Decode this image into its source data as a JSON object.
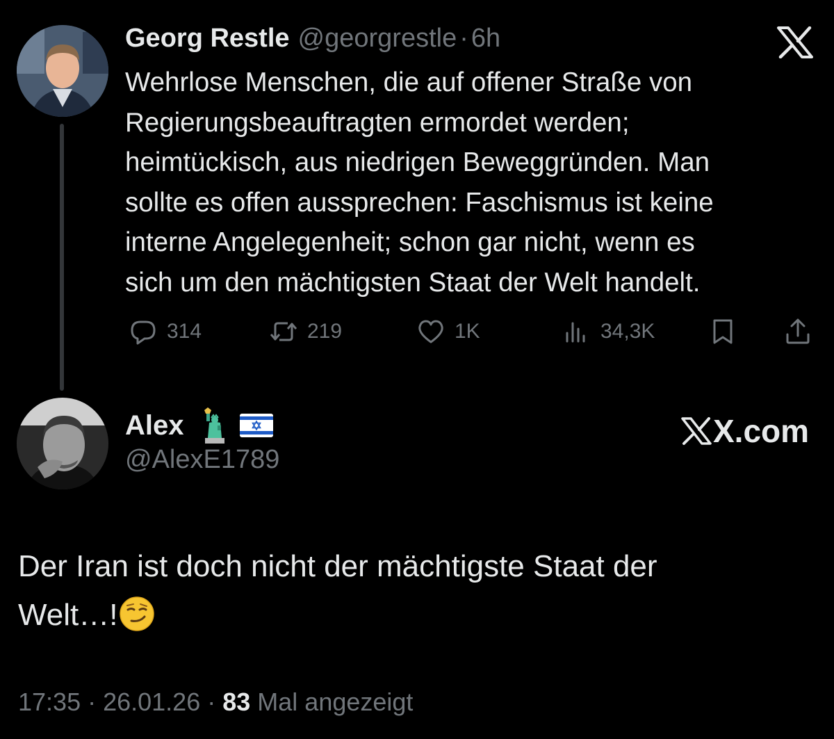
{
  "tweet": {
    "author": {
      "display_name": "Georg Restle",
      "handle": "@georgrestle",
      "separator": "·",
      "time": "6h"
    },
    "text_lines": [
      "Wehrlose Menschen, die auf offener Straße von",
      "Regierungsbeauftragten ermordet werden;",
      "heimtückisch, aus niedrigen Beweggründen. Man",
      "sollte es offen aussprechen: Faschismus ist keine",
      "interne Angelegenheit; schon gar nicht, wenn es",
      "sich um den mächtigsten Staat der Welt handelt."
    ],
    "actions": {
      "replies": "314",
      "retweets": "219",
      "likes": "1K",
      "views": "34,3K"
    }
  },
  "reply": {
    "author": {
      "display_name": "Alex",
      "handle": "@AlexE1789",
      "emojis": [
        "statue-of-liberty",
        "israel-flag"
      ]
    },
    "text_lines": [
      "Der Iran ist doch nicht der mächtigste Staat der",
      "Welt…!"
    ],
    "trailing_emoji": "smirking-face",
    "meta": {
      "time": "17:35",
      "separator": "·",
      "date": "26.01.26",
      "views_count": "83",
      "views_label": "Mal angezeigt"
    }
  },
  "branding": {
    "watermark": "X.com"
  },
  "colors": {
    "background": "#000000",
    "primary_text": "#e7e9ea",
    "secondary_text": "#71767b",
    "thread_line": "#333639"
  },
  "icons": [
    "x-logo-icon",
    "reply-icon",
    "retweet-icon",
    "like-icon",
    "views-icon",
    "bookmark-icon",
    "share-icon"
  ]
}
